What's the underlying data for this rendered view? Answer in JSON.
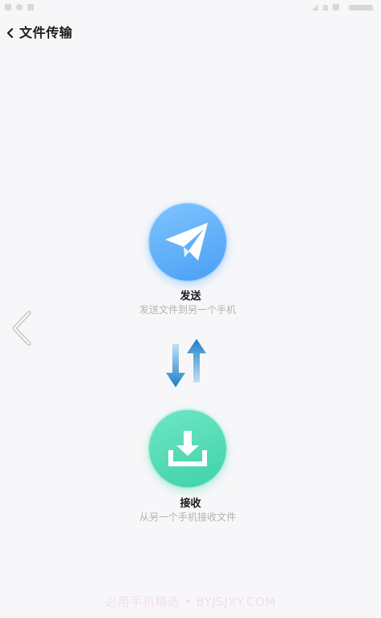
{
  "header": {
    "title": "文件传输",
    "back_icon": "chevron-left-icon"
  },
  "send": {
    "label": "发送",
    "description": "发送文件到另一个手机",
    "icon": "paper-plane-icon",
    "color": "#5aa9f7"
  },
  "transfer": {
    "icon": "transfer-arrows-icon"
  },
  "receive": {
    "label": "接收",
    "description": "从另一个手机接收文件",
    "icon": "download-tray-icon",
    "color": "#46d6b0"
  },
  "nav": {
    "side_icon": "chevron-left-outline-icon"
  },
  "watermark": {
    "text": "必用手机精选 • BYJSJXY.COM"
  }
}
